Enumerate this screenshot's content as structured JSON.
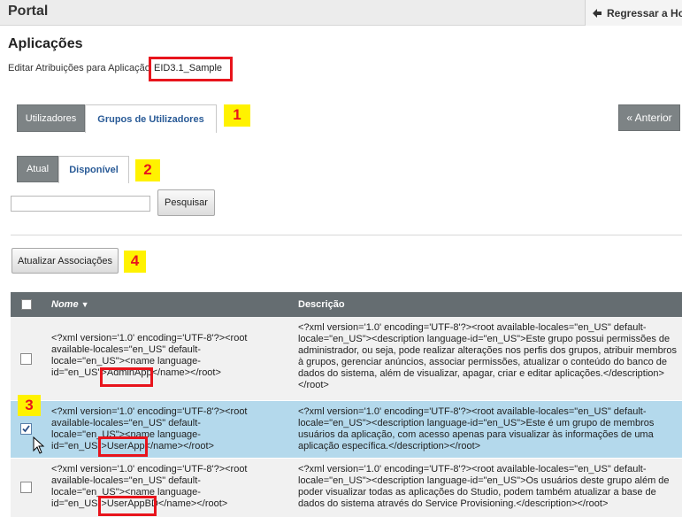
{
  "topbar": {
    "title": "Portal",
    "back_link": "Regressar a Ho"
  },
  "header": {
    "title": "Aplicações",
    "edit_label": "Editar Atribuições para Aplicação",
    "app_name": "EID3.1_Sample"
  },
  "tabs": [
    {
      "label": "Utilizadores",
      "active": false
    },
    {
      "label": "Grupos de Utilizadores",
      "active": true
    }
  ],
  "subtabs": [
    {
      "label": "Atual",
      "active": false
    },
    {
      "label": "Disponível",
      "active": true
    }
  ],
  "prev_button": "« Anterior",
  "search": {
    "value": "",
    "button": "Pesquisar"
  },
  "update_button": "Atualizar Associações",
  "badges": [
    "1",
    "2",
    "3",
    "4"
  ],
  "table": {
    "headers": {
      "name": "Nome",
      "description": "Descrição"
    },
    "rows": [
      {
        "name_prefix": "<?xml version='1.0' encoding='UTF-8'?><root available-locales=\"en_US\" default-locale=\"en_US\"><name language-id=\"en_US\">",
        "name_value": "AdminApp",
        "name_suffix": "</name></root>",
        "description": "<?xml version='1.0' encoding='UTF-8'?><root available-locales=\"en_US\" default-locale=\"en_US\"><description language-id=\"en_US\">Este grupo possui permissões de administrador, ou seja, pode realizar alterações nos perfis dos grupos, atribuir membros à grupos, gerenciar anúncios, associar permissões, atualizar o conteúdo do banco de dados do sistema, além de visualizar, apagar, criar e editar aplicações.</description></root>",
        "checked": false
      },
      {
        "name_prefix": "<?xml version='1.0' encoding='UTF-8'?><root available-locales=\"en_US\" default-locale=\"en_US\"><name language-id=\"en_US\">",
        "name_value": "UserApp",
        "name_suffix": "</name></root>",
        "description": "<?xml version='1.0' encoding='UTF-8'?><root available-locales=\"en_US\" default-locale=\"en_US\"><description language-id=\"en_US\">Este é um grupo de membros usuários da aplicação, com acesso apenas para visualizar às informações de uma aplicação específica.</description></root>",
        "checked": true
      },
      {
        "name_prefix": "<?xml version='1.0' encoding='UTF-8'?><root available-locales=\"en_US\" default-locale=\"en_US\"><name language-id=\"en_US\">",
        "name_value": "UserAppBD",
        "name_suffix": "</name></root>",
        "description": "<?xml version='1.0' encoding='UTF-8'?><root available-locales=\"en_US\" default-locale=\"en_US\"><description language-id=\"en_US\">Os usuários deste grupo além de poder visualizar todas as aplicações do Studio, podem também atualizar a base de dados do sistema através do Service Provisioning.</description></root>",
        "checked": false
      }
    ]
  },
  "colors": {
    "annotation_red": "#e8141c",
    "annotation_yellow": "#fff200",
    "selected_row": "#b4d9ec",
    "header_bg": "#656d71",
    "tab_inactive": "#7d8385",
    "tab_active_text": "#2a5b97"
  }
}
